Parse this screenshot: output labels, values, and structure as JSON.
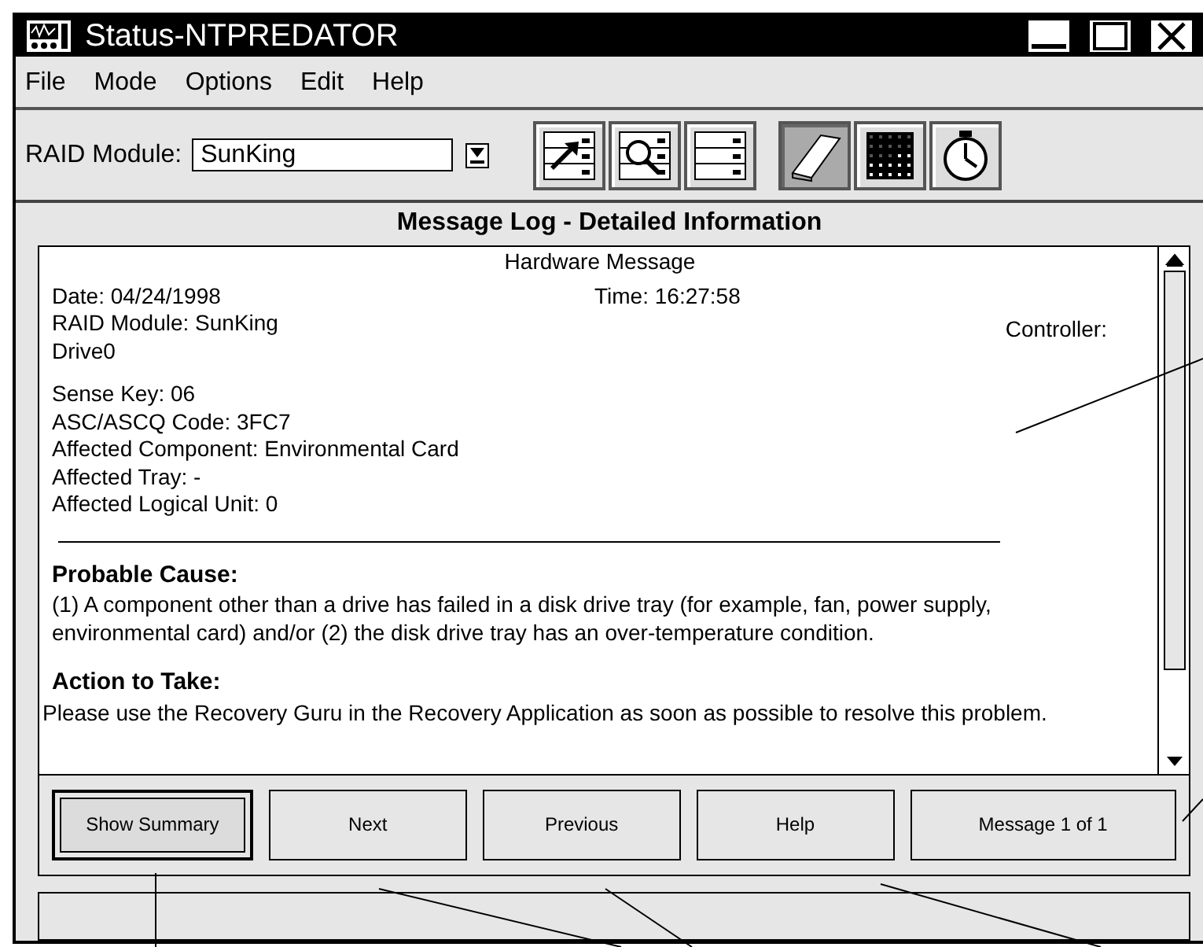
{
  "window": {
    "title": "Status-NTPREDATOR"
  },
  "menu": [
    {
      "label": "File"
    },
    {
      "label": "Mode"
    },
    {
      "label": "Options"
    },
    {
      "label": "Edit"
    },
    {
      "label": "Help"
    }
  ],
  "toolbar": {
    "module_label": "RAID Module:",
    "module_value": "SunKing",
    "tools": [
      {
        "kind": "arrow",
        "selected": false
      },
      {
        "kind": "magnifier",
        "selected": false
      },
      {
        "kind": "drives",
        "selected": false
      },
      {
        "kind": "log",
        "selected": true
      },
      {
        "kind": "grid",
        "selected": false
      },
      {
        "kind": "stopwatch",
        "selected": false
      }
    ]
  },
  "heading": "Message Log - Detailed Information",
  "message": {
    "title": "Hardware Message",
    "date": "Date: 04/24/1998",
    "time": "Time: 16:27:58",
    "module": "RAID Module: SunKing",
    "controller": "Controller:",
    "drive": "Drive0",
    "details": [
      "Sense Key: 06",
      "ASC/ASCQ Code: 3FC7",
      "Affected Component: Environmental Card",
      "Affected Tray: -",
      "Affected Logical Unit: 0"
    ],
    "cause_heading": "Probable Cause:",
    "cause": "(1) A component other than a drive has failed in a disk drive tray (for example, fan, power supply, environmental card) and/or (2) the disk drive tray has an over-temperature condition.",
    "action_heading": "Action to Take:",
    "action": "Please use the Recovery Guru in the Recovery Application as soon as possible to resolve this problem."
  },
  "buttons": [
    {
      "label": "Show Summary",
      "focused": true
    },
    {
      "label": "Next",
      "focused": false
    },
    {
      "label": "Previous",
      "focused": false
    },
    {
      "label": "Help",
      "focused": false
    },
    {
      "label": "Message 1 of 1",
      "focused": false
    }
  ]
}
